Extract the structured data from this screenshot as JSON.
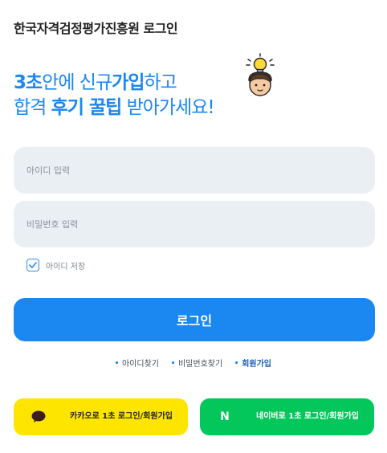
{
  "header": {
    "title": "한국자격검정평가진흥원 로그인"
  },
  "promo": {
    "line1": {
      "bold1": "3초",
      "text1": "안에 신규",
      "bold2": "가입",
      "text2": "하고"
    },
    "line2": {
      "text1": "합격 ",
      "bold1": "후기 꿀팁",
      "text2": " 받아가세요!"
    }
  },
  "form": {
    "id_placeholder": "아이디 입력",
    "id_value": "",
    "pw_placeholder": "비밀번호 입력",
    "pw_value": "",
    "remember_label": "아이디 저장",
    "remember_checked": true,
    "login_label": "로그인"
  },
  "links": [
    {
      "label": "아이디찾기"
    },
    {
      "label": "비밀번호찾기"
    },
    {
      "label": "회원가입"
    }
  ],
  "social": {
    "kakao_label": "카카오로 1초 로그인/회원가입",
    "naver_label": "네이버로 1초 로그인/회원가입",
    "naver_icon_text": "N"
  },
  "colors": {
    "accent": "#1b87f0",
    "input_bg": "#e9eff3",
    "kakao": "#fee500",
    "naver": "#03c75a"
  },
  "icons": {
    "mascot": "lightbulb-character-icon",
    "check": "check-icon",
    "kakao": "kakao-chat-bubble-icon",
    "naver": "naver-n-icon"
  }
}
